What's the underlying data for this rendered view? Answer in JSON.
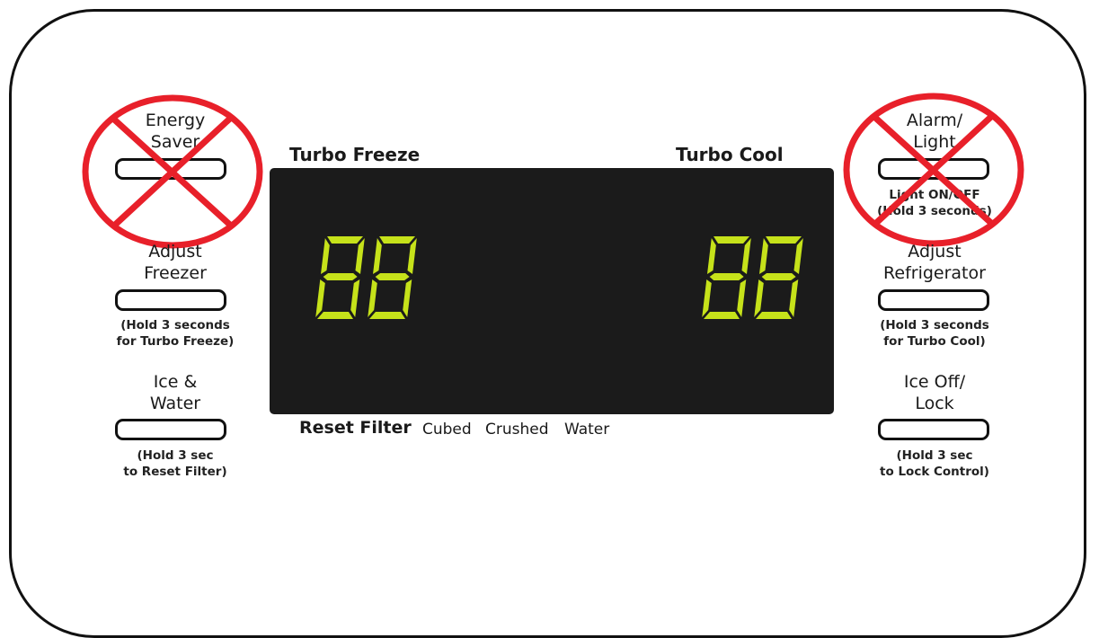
{
  "left_controls": {
    "energy_saver": {
      "label_line1": "Energy",
      "label_line2": "Saver",
      "disabled": true
    },
    "adjust_freezer": {
      "label_line1": "Adjust",
      "label_line2": "Freezer",
      "note_line1": "(Hold 3 seconds",
      "note_line2": "for Turbo Freeze)"
    },
    "ice_water": {
      "label_line1": "Ice &",
      "label_line2": "Water",
      "note_line1": "(Hold 3 sec",
      "note_line2": "to Reset Filter)"
    }
  },
  "right_controls": {
    "alarm_light": {
      "label_line1": "Alarm/",
      "label_line2": "Light",
      "note_line1": "Light ON/OFF",
      "note_line2": "(Hold 3 seconds)",
      "disabled": true
    },
    "adjust_refrigerator": {
      "label_line1": "Adjust",
      "label_line2": "Refrigerator",
      "note_line1": "(Hold 3 seconds",
      "note_line2": "for Turbo Cool)"
    },
    "ice_off_lock": {
      "label_line1": "Ice Off/",
      "label_line2": "Lock",
      "note_line1": "(Hold 3 sec",
      "note_line2": "to Lock Control)"
    }
  },
  "display": {
    "turbo_freeze_label": "Turbo Freeze",
    "turbo_cool_label": "Turbo Cool",
    "reset_filter_label": "Reset Filter",
    "dispenser_options": [
      "Cubed",
      "Crushed",
      "Water"
    ],
    "freezer_digits": "88",
    "fridge_digits": "88",
    "screen_color": "#1b1b1b",
    "segment_color": "#c6e21a"
  },
  "colors": {
    "prohibited_sign": "#e8202a",
    "outline": "#111111"
  }
}
